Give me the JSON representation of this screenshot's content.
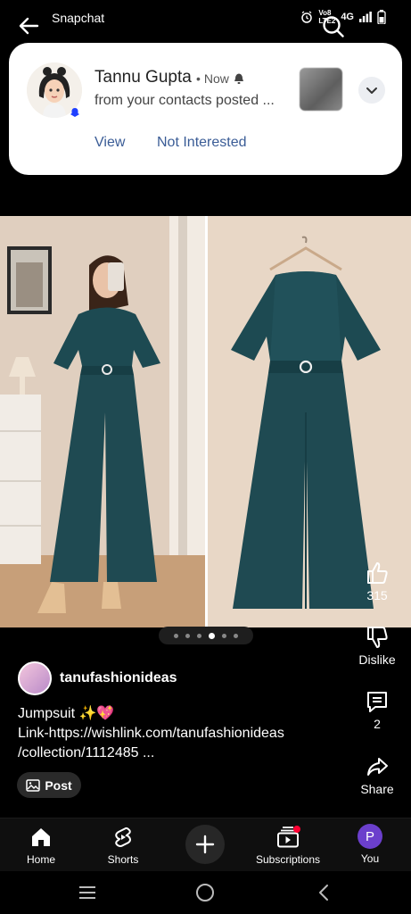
{
  "status_bar": {
    "app_name": "Snapchat",
    "network_label_top": "Vo8",
    "network_label_bottom": "LTE2",
    "network_type": "4G"
  },
  "notification": {
    "sender": "Tannu Gupta",
    "time": "Now",
    "body": "from your contacts posted ...",
    "actions": [
      "View",
      "Not Interested"
    ]
  },
  "carousel": {
    "count": 6,
    "active_index": 3
  },
  "actions": {
    "like_count": "315",
    "dislike_label": "Dislike",
    "comment_count": "2",
    "share_label": "Share"
  },
  "channel": {
    "name": "tanufashionideas"
  },
  "caption": {
    "line1": "Jumpsuit ✨💖",
    "line2": "Link-https://wishlink.com/tanufashionideas",
    "line3": "/collection/1112485 ..."
  },
  "post_chip": {
    "label": "Post"
  },
  "bottom_nav": {
    "items": [
      {
        "label": "Home",
        "icon": "home-icon"
      },
      {
        "label": "Shorts",
        "icon": "shorts-icon"
      },
      {
        "label": "Subscriptions",
        "icon": "subscriptions-icon"
      },
      {
        "label": "You",
        "icon": "avatar"
      }
    ],
    "you_initial": "P"
  },
  "colors": {
    "background": "#000000",
    "notification_bg": "#ffffff",
    "notification_action": "#3a5c96",
    "jumpsuit_teal": "#1f4a52",
    "you_avatar": "#6b3fcc",
    "badge_red": "#ff0033"
  }
}
